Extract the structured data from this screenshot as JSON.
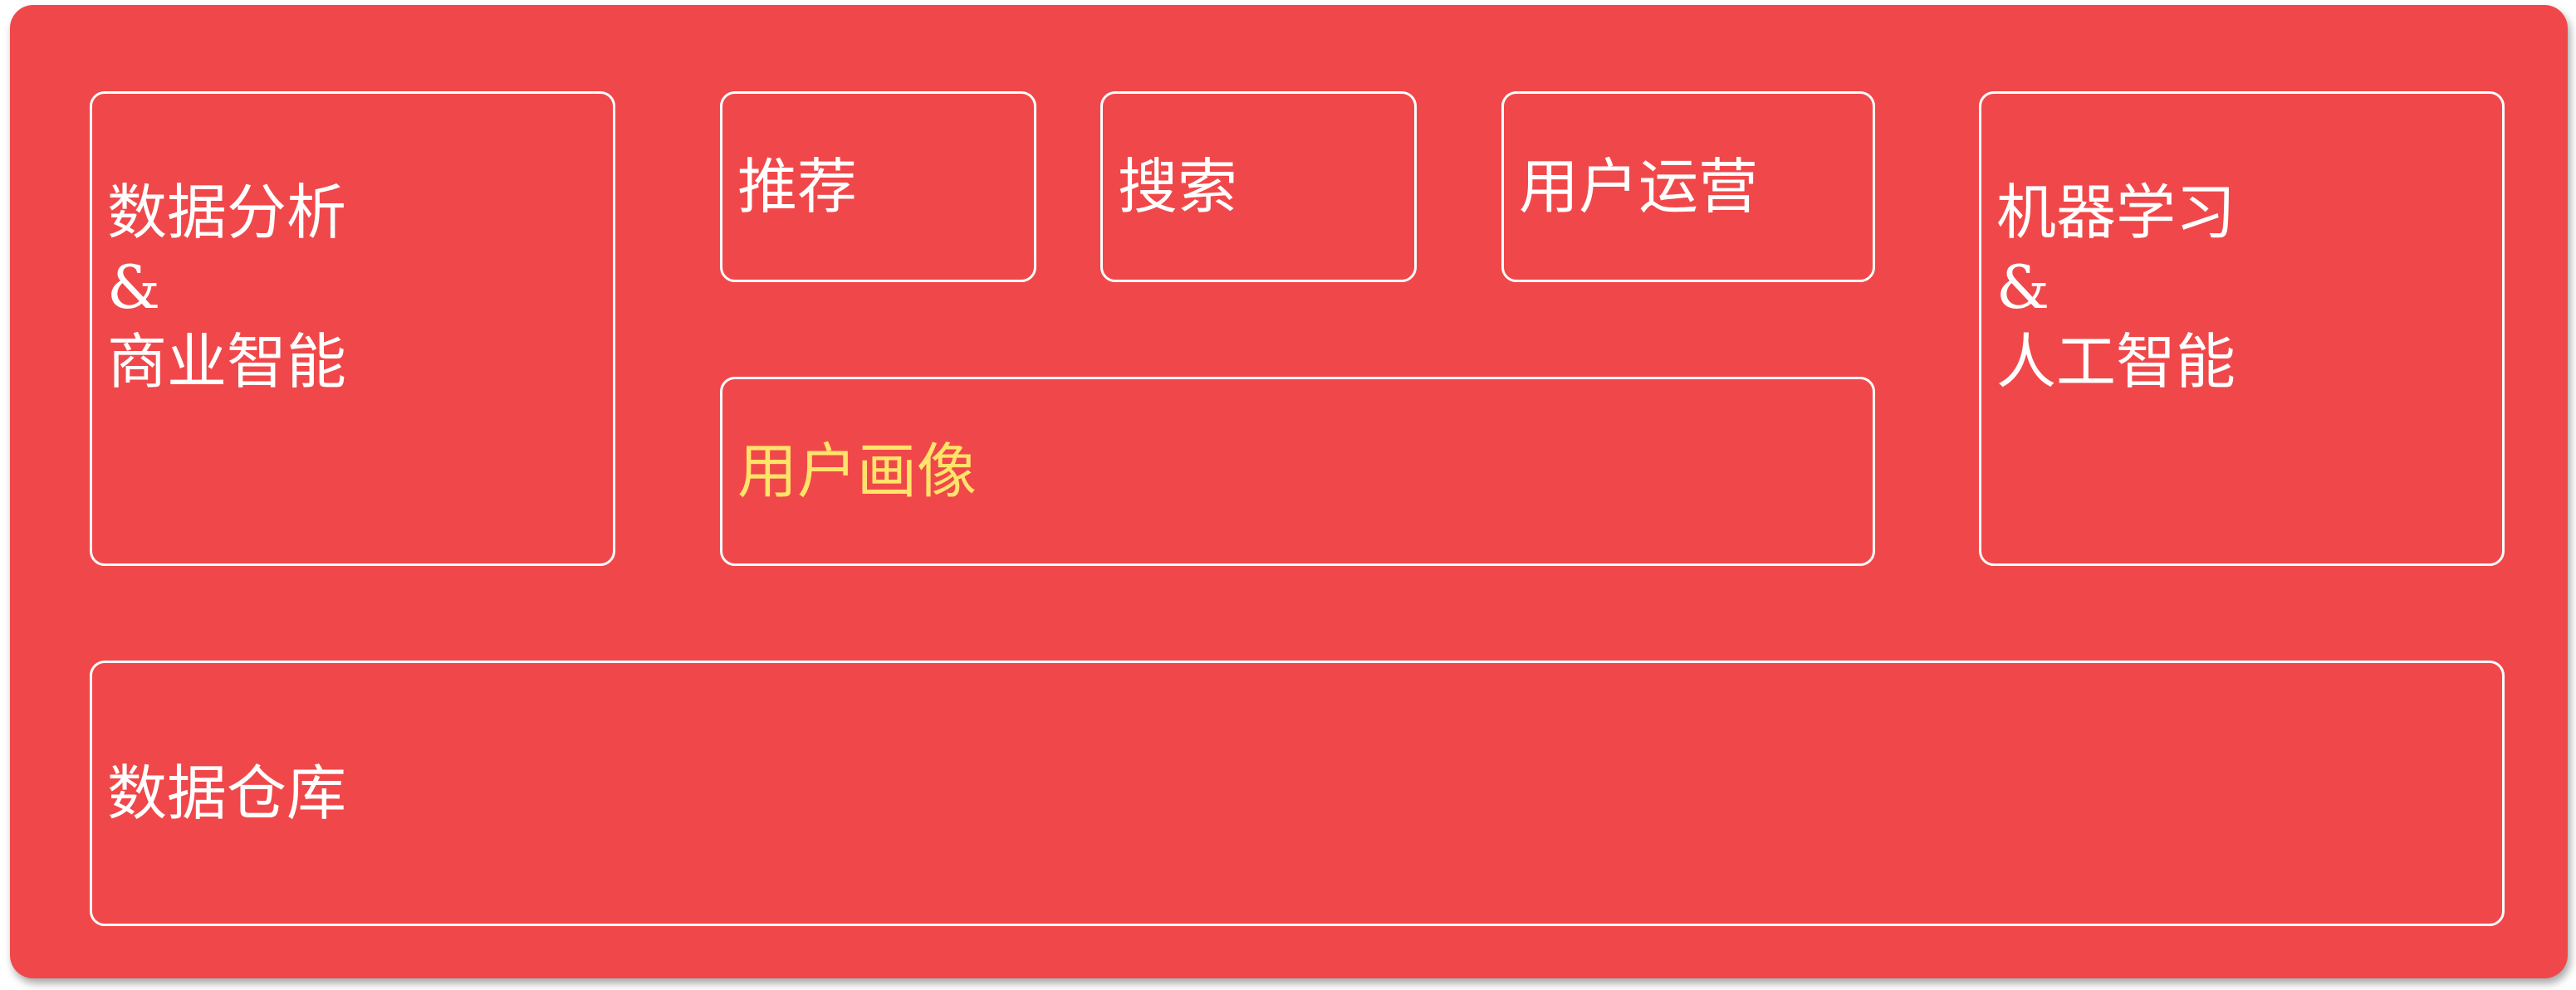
{
  "diagram": {
    "boxes": {
      "data_analysis": "数据分析\n&\n商业智能",
      "recommendation": "推荐",
      "search": "搜索",
      "user_operations": "用户运营",
      "machine_learning": "机器学习\n&\n人工智能",
      "user_profile": "用户画像",
      "data_warehouse": "数据仓库"
    },
    "colors": {
      "background": "#f0484a",
      "border": "#ffffff",
      "text": "#ffffff",
      "highlight_text": "#ffe36a"
    }
  }
}
